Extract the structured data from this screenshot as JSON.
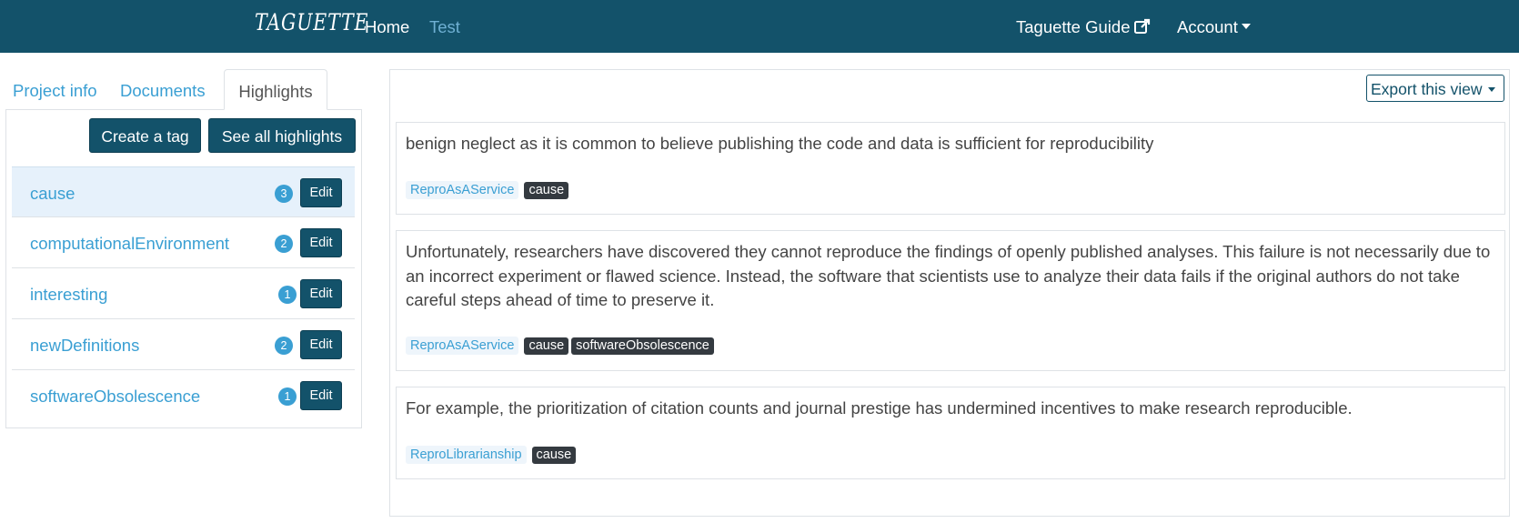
{
  "navbar": {
    "brand": "TAGUETTE",
    "home": "Home",
    "project": "Test",
    "guide": "Taguette Guide",
    "account": "Account"
  },
  "tabs": {
    "project_info": "Project info",
    "documents": "Documents",
    "highlights": "Highlights"
  },
  "left": {
    "create_tag": "Create a tag",
    "see_all": "See all highlights",
    "edit_label": "Edit",
    "tags": [
      {
        "name": "cause",
        "count": "3"
      },
      {
        "name": "computationalEnvironment",
        "count": "2"
      },
      {
        "name": "interesting",
        "count": "1"
      },
      {
        "name": "newDefinitions",
        "count": "2"
      },
      {
        "name": "softwareObsolescence",
        "count": "1"
      }
    ]
  },
  "right": {
    "export": "Export this view",
    "highlights": [
      {
        "text": "benign neglect as it is common to believe publishing the code and data is sufficient for reproducibility",
        "document": "ReproAsAService",
        "tags": [
          "cause"
        ]
      },
      {
        "text": "Unfortunately, researchers have discovered they cannot reproduce the findings of openly published analyses. This failure is not necessarily due to an incorrect experiment or flawed science. Instead, the software that scientists use to analyze their data fails if the original authors do not take careful steps ahead of time to preserve it.",
        "document": "ReproAsAService",
        "tags": [
          "cause",
          "softwareObsolescence"
        ]
      },
      {
        "text": "For example, the prioritization of citation counts and journal prestige has undermined incentives to make research reproducible.",
        "document": "ReproLibrarianship",
        "tags": [
          "cause"
        ]
      }
    ]
  },
  "colors": {
    "navbar": "#13526a",
    "link": "#3a9fd3",
    "tag_badge": "#343a40",
    "active_row": "#e6f1fb"
  },
  "icons": {
    "guide": "external-link-icon",
    "account": "caret-down-icon",
    "export": "caret-down-icon"
  }
}
